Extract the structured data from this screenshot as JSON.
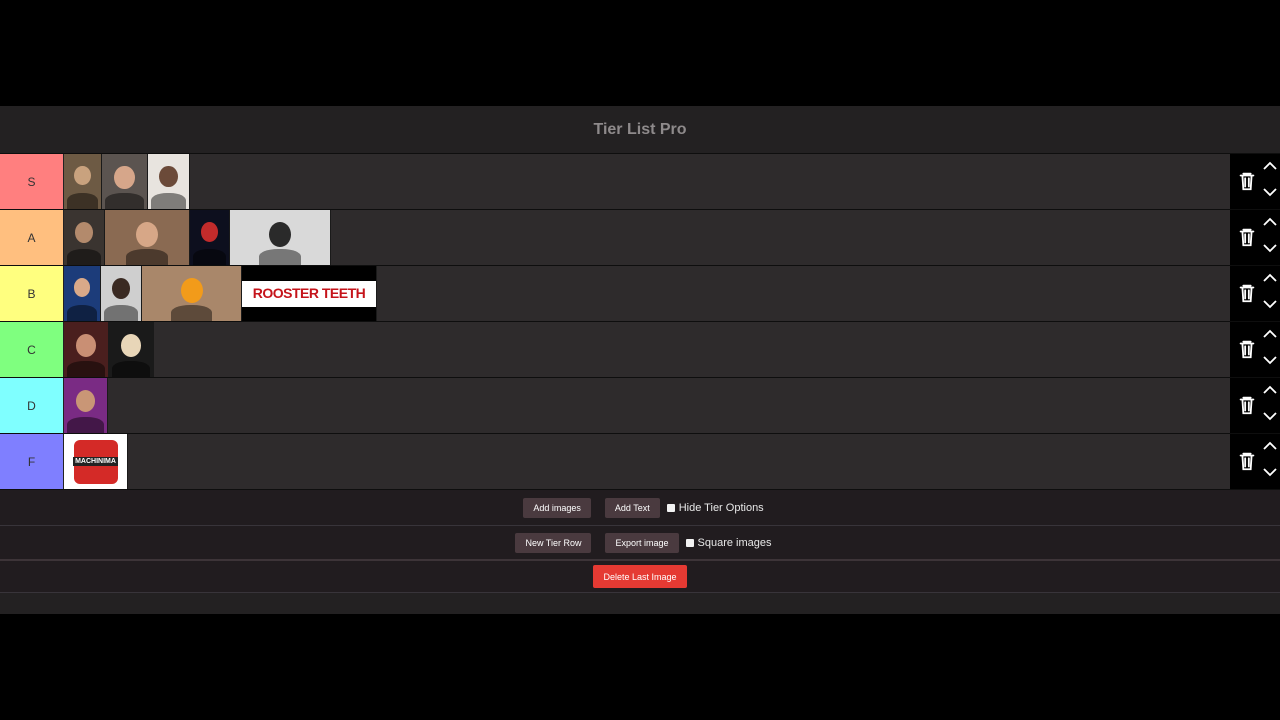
{
  "app": {
    "title": "Tier List Pro"
  },
  "tiers": [
    {
      "label": "S",
      "color": "#ff7f7f",
      "items": [
        {
          "name": "tier-item-man-glasses",
          "w": 37,
          "bg": "#6d5a44",
          "fg": "#c9a27e"
        },
        {
          "name": "tier-item-man-beard",
          "w": 45,
          "bg": "#5b5450",
          "fg": "#d6a68a"
        },
        {
          "name": "tier-item-man-red-shirt",
          "w": 41,
          "bg": "#e8e4df",
          "fg": "#6b4a39"
        }
      ]
    },
    {
      "label": "A",
      "color": "#ffbf7f",
      "items": [
        {
          "name": "tier-item-man-dark",
          "w": 40,
          "bg": "#3a3430",
          "fg": "#b38a6c"
        },
        {
          "name": "tier-item-group-of-men",
          "w": 84,
          "bg": "#8a6a52",
          "fg": "#d7a787"
        },
        {
          "name": "tier-item-red-helmet",
          "w": 39,
          "bg": "#0d0f1e",
          "fg": "#c22b2b"
        },
        {
          "name": "tier-item-man-at-desk",
          "w": 100,
          "bg": "#d9d9d9",
          "fg": "#2a2a2a"
        }
      ]
    },
    {
      "label": "B",
      "color": "#ffff7f",
      "items": [
        {
          "name": "tier-item-man-smiling",
          "w": 36,
          "bg": "#1c3c7a",
          "fg": "#d9a989"
        },
        {
          "name": "tier-item-man-black-hair",
          "w": 40,
          "bg": "#cfcfcf",
          "fg": "#3a2a22"
        },
        {
          "name": "tier-item-annoying-orange",
          "w": 99,
          "bg": "#a9876a",
          "fg": "#f29b1a"
        },
        {
          "name": "tier-item-rooster-teeth-logo",
          "w": 134,
          "bg": "#ffffff",
          "fg": "#c5141b",
          "text": "ROOSTER TEETH"
        }
      ]
    },
    {
      "label": "C",
      "color": "#7fff7f",
      "items": [
        {
          "name": "tier-item-woman-brown-hair",
          "w": 44,
          "bg": "#4a1f1e",
          "fg": "#c98f74"
        },
        {
          "name": "tier-item-woman-blonde",
          "w": 44,
          "bg": "#1a1a1a",
          "fg": "#e8d6b8"
        }
      ]
    },
    {
      "label": "D",
      "color": "#7fffff",
      "items": [
        {
          "name": "tier-item-man-purple-bg",
          "w": 43,
          "bg": "#7a2b84",
          "fg": "#c99676"
        }
      ]
    },
    {
      "label": "F",
      "color": "#7f7fff",
      "items": [
        {
          "name": "tier-item-machinima-logo",
          "w": 63,
          "bg": "#ffffff",
          "fg": "#d42a27",
          "text": "MACHINIMA"
        }
      ]
    }
  ],
  "toolbar1": {
    "add_images": "Add images",
    "add_text": "Add Text",
    "hide_tier_options": "Hide Tier Options"
  },
  "toolbar2": {
    "new_tier_row": "New Tier Row",
    "export_image": "Export image",
    "square_images": "Square images"
  },
  "toolbar3": {
    "delete_last_image": "Delete Last Image"
  },
  "icons": {
    "delete": "trash-icon",
    "up": "chevron-up-icon",
    "down": "chevron-down-icon",
    "checkbox": "checkbox-icon"
  }
}
